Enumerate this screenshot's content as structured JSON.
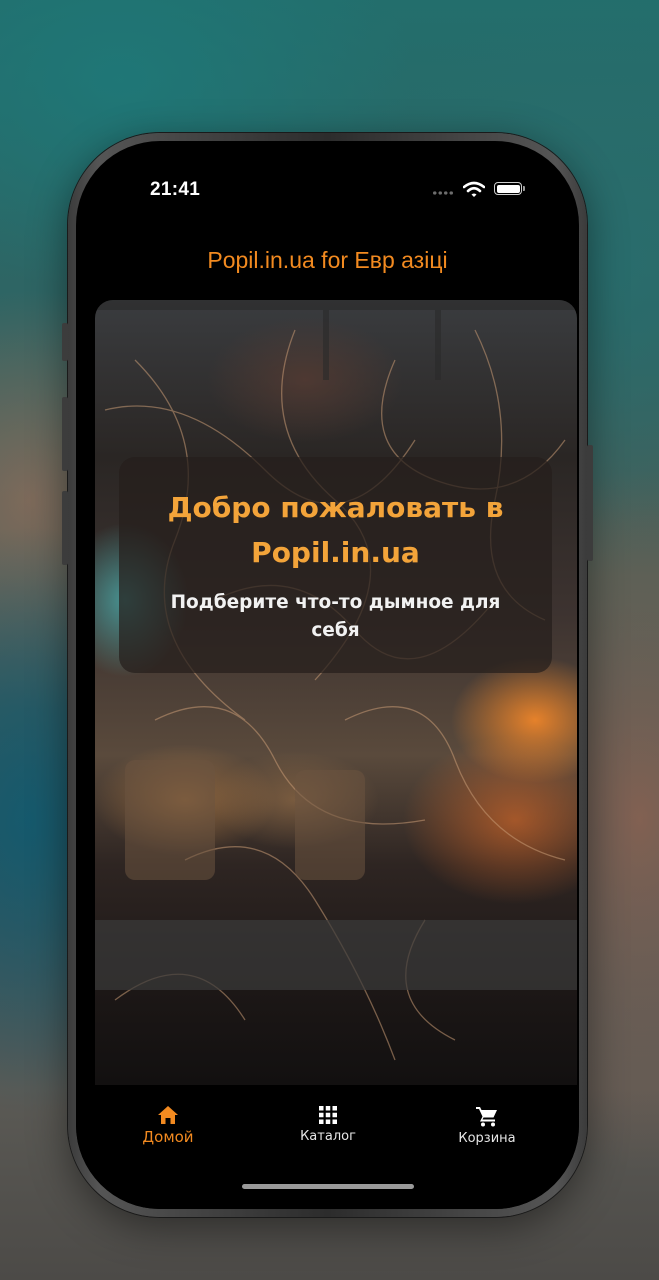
{
  "status_bar": {
    "time": "21:41"
  },
  "header": {
    "title": "Popil.in.ua for Евр азіці"
  },
  "hero": {
    "welcome_title": "Добро пожаловать в Popil.in.ua",
    "welcome_subtitle": "Подберите что-то дымное для себя"
  },
  "tab_bar": {
    "items": [
      {
        "label": "Домой",
        "icon": "home-icon",
        "active": true
      },
      {
        "label": "Каталог",
        "icon": "grid-icon",
        "active": false
      },
      {
        "label": "Корзина",
        "icon": "cart-icon",
        "active": false
      }
    ]
  },
  "colors": {
    "accent": "#f28a20",
    "welcome_title": "#f3a43a",
    "background": "#000000"
  }
}
